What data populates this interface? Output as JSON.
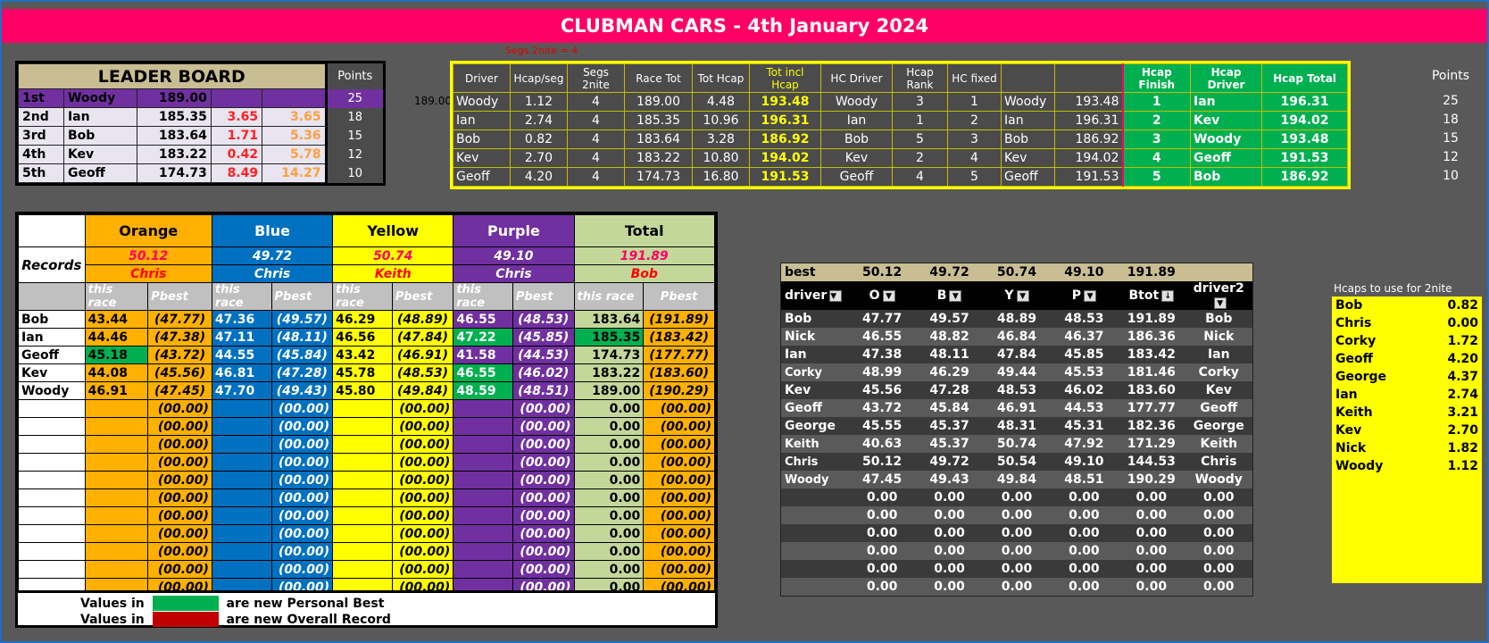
{
  "title": "CLUBMAN CARS - 4th January 2024",
  "segs_note": "Segs 2nite =   4",
  "side_number": "189.00",
  "leader_board": {
    "heading": "LEADER BOARD",
    "points_label": "Points",
    "rows": [
      {
        "pos": "1st",
        "name": "Woody",
        "score": "189.00",
        "gap": "",
        "cum": "",
        "points": "25"
      },
      {
        "pos": "2nd",
        "name": "Ian",
        "score": "185.35",
        "gap": "3.65",
        "cum": "3.65",
        "points": "18"
      },
      {
        "pos": "3rd",
        "name": "Bob",
        "score": "183.64",
        "gap": "1.71",
        "cum": "5.36",
        "points": "15"
      },
      {
        "pos": "4th",
        "name": "Kev",
        "score": "183.22",
        "gap": "0.42",
        "cum": "5.78",
        "points": "12"
      },
      {
        "pos": "5th",
        "name": "Geoff",
        "score": "174.73",
        "gap": "8.49",
        "cum": "14.27",
        "points": "10"
      }
    ]
  },
  "results": {
    "headers": [
      "Driver",
      "Hcap/seg",
      "Segs 2nite",
      "Race Tot",
      "Tot Hcap",
      "Tot incl Hcap",
      "HC Driver",
      "Hcap Rank",
      "HC fixed",
      "",
      "",
      "Hcap Finish",
      "Hcap Driver",
      "Hcap Total"
    ],
    "points_label": "Points",
    "rows": [
      [
        "Woody",
        "1.12",
        "4",
        "189.00",
        "4.48",
        "193.48",
        "Woody",
        "3",
        "1",
        "Woody",
        "193.48",
        "1",
        "Ian",
        "196.31"
      ],
      [
        "Ian",
        "2.74",
        "4",
        "185.35",
        "10.96",
        "196.31",
        "Ian",
        "1",
        "2",
        "Ian",
        "196.31",
        "2",
        "Kev",
        "194.02"
      ],
      [
        "Bob",
        "0.82",
        "4",
        "183.64",
        "3.28",
        "186.92",
        "Bob",
        "5",
        "3",
        "Bob",
        "186.92",
        "3",
        "Woody",
        "193.48"
      ],
      [
        "Kev",
        "2.70",
        "4",
        "183.22",
        "10.80",
        "194.02",
        "Kev",
        "2",
        "4",
        "Kev",
        "194.02",
        "4",
        "Geoff",
        "191.53"
      ],
      [
        "Geoff",
        "4.20",
        "4",
        "174.73",
        "16.80",
        "191.53",
        "Geoff",
        "4",
        "5",
        "Geoff",
        "191.53",
        "5",
        "Bob",
        "186.92"
      ]
    ],
    "points": [
      "25",
      "18",
      "15",
      "12",
      "10"
    ]
  },
  "records": {
    "label": "Records",
    "columns": [
      "Orange",
      "Blue",
      "Yellow",
      "Purple",
      "Total"
    ],
    "record_values": [
      "50.12",
      "49.72",
      "50.74",
      "49.10",
      "191.89"
    ],
    "record_holders": [
      "Chris",
      "Chris",
      "Keith",
      "Chris",
      "Bob"
    ],
    "sub_headers": [
      "this race",
      "Pbest"
    ],
    "rows": [
      {
        "name": "Bob",
        "vals": [
          "43.44",
          "(47.77)",
          "47.36",
          "(49.57)",
          "46.29",
          "(48.89)",
          "46.55",
          "(48.53)",
          "183.64",
          "(191.89)"
        ]
      },
      {
        "name": "Ian",
        "vals": [
          "44.46",
          "(47.38)",
          "47.11",
          "(48.11)",
          "46.56",
          "(47.84)",
          "47.22",
          "(45.85)",
          "185.35",
          "(183.42)"
        ]
      },
      {
        "name": "Geoff",
        "vals": [
          "45.18",
          "(43.72)",
          "44.55",
          "(45.84)",
          "43.42",
          "(46.91)",
          "41.58",
          "(44.53)",
          "174.73",
          "(177.77)"
        ]
      },
      {
        "name": "Kev",
        "vals": [
          "44.08",
          "(45.56)",
          "46.81",
          "(47.28)",
          "45.78",
          "(48.53)",
          "46.55",
          "(46.02)",
          "183.22",
          "(183.60)"
        ]
      },
      {
        "name": "Woody",
        "vals": [
          "46.91",
          "(47.45)",
          "47.70",
          "(49.43)",
          "45.80",
          "(49.84)",
          "48.59",
          "(48.51)",
          "189.00",
          "(190.29)"
        ]
      }
    ],
    "empty_pbest": "(00.00)",
    "empty_total": "0.00",
    "empty_rows": 11
  },
  "legend": {
    "values_in": "Values in",
    "pb_text": "are new Personal Best",
    "rec_text": "are new Overall Record",
    "pb_color": "#00b050",
    "rec_color": "#c00000"
  },
  "best": {
    "head": [
      "best",
      "50.12",
      "49.72",
      "50.74",
      "49.10",
      "191.89",
      ""
    ],
    "cols": [
      "driver",
      "O",
      "B",
      "Y",
      "P",
      "Btot",
      "driver2"
    ],
    "rows": [
      [
        "Bob",
        "47.77",
        "49.57",
        "48.89",
        "48.53",
        "191.89",
        "Bob"
      ],
      [
        "Nick",
        "46.55",
        "48.82",
        "46.84",
        "46.37",
        "186.36",
        "Nick"
      ],
      [
        "Ian",
        "47.38",
        "48.11",
        "47.84",
        "45.85",
        "183.42",
        "Ian"
      ],
      [
        "Corky",
        "48.99",
        "46.29",
        "49.44",
        "45.53",
        "181.46",
        "Corky"
      ],
      [
        "Kev",
        "45.56",
        "47.28",
        "48.53",
        "46.02",
        "183.60",
        "Kev"
      ],
      [
        "Geoff",
        "43.72",
        "45.84",
        "46.91",
        "44.53",
        "177.77",
        "Geoff"
      ],
      [
        "George",
        "45.55",
        "45.37",
        "48.31",
        "45.31",
        "182.36",
        "George"
      ],
      [
        "Keith",
        "40.63",
        "45.37",
        "50.74",
        "47.92",
        "171.29",
        "Keith"
      ],
      [
        "Chris",
        "50.12",
        "49.72",
        "50.54",
        "49.10",
        "144.53",
        "Chris"
      ],
      [
        "Woody",
        "47.45",
        "49.43",
        "49.84",
        "48.51",
        "190.29",
        "Woody"
      ]
    ],
    "zero": "0.00",
    "zero_rows": 6
  },
  "hcaps": {
    "title": "Hcaps to use for 2nite",
    "rows": [
      [
        "Bob",
        "0.82"
      ],
      [
        "Chris",
        "0.00"
      ],
      [
        "Corky",
        "1.72"
      ],
      [
        "Geoff",
        "4.20"
      ],
      [
        "George",
        "4.37"
      ],
      [
        "Ian",
        "2.74"
      ],
      [
        "Keith",
        "3.21"
      ],
      [
        "Kev",
        "2.70"
      ],
      [
        "Nick",
        "1.82"
      ],
      [
        "Woody",
        "1.12"
      ]
    ]
  }
}
